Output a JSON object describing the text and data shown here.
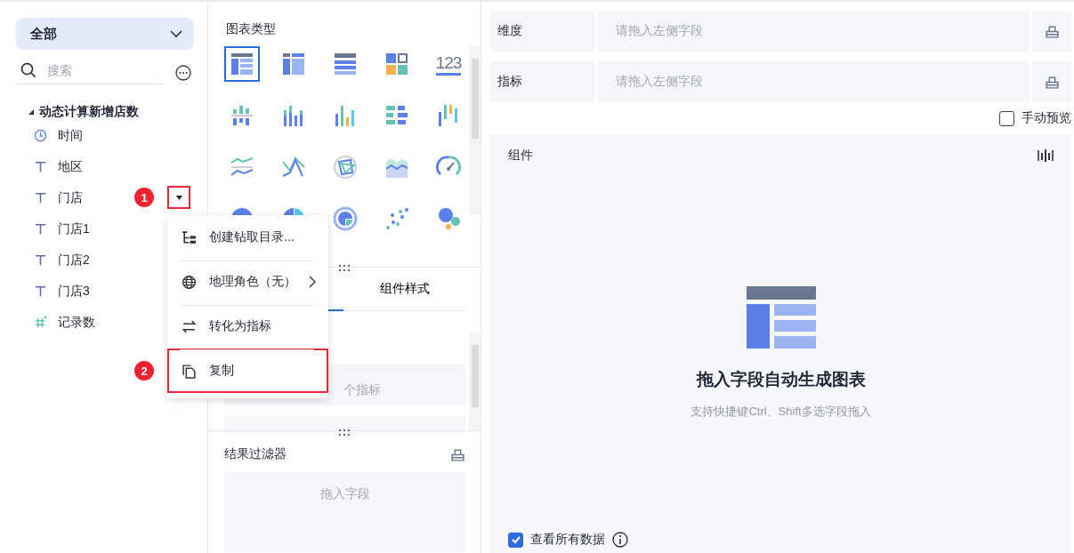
{
  "sidebar": {
    "scope_select": {
      "value": "全部"
    },
    "search": {
      "placeholder": "搜索"
    },
    "tree": [
      {
        "label": "动态计算新增店数",
        "expanded": true,
        "children": [
          {
            "label": "时间",
            "kind": "time"
          },
          {
            "label": "地区",
            "kind": "text"
          },
          {
            "label": "门店",
            "kind": "text",
            "badge": "1",
            "dropdown": true
          },
          {
            "label": "门店1",
            "kind": "text"
          },
          {
            "label": "门店2",
            "kind": "text"
          },
          {
            "label": "门店3",
            "kind": "text"
          },
          {
            "label": "记录数",
            "kind": "measure"
          }
        ]
      }
    ]
  },
  "context_menu": {
    "items": [
      {
        "label": "创建钻取目录...",
        "kind": "tree",
        "submenu": false,
        "highlighted": false
      },
      {
        "label": "地理角色（无）",
        "kind": "globe",
        "submenu": true,
        "highlighted": false
      },
      {
        "label": "转化为指标",
        "kind": "swap",
        "submenu": false,
        "highlighted": false
      },
      {
        "label": "复制",
        "kind": "copy",
        "submenu": false,
        "highlighted": true,
        "badge": "2"
      }
    ]
  },
  "chart_panel": {
    "title": "图表类型",
    "chart_types": [
      {
        "kind": "grouped-table",
        "selected": true
      },
      {
        "kind": "cross-table",
        "selected": false
      },
      {
        "kind": "detail-table",
        "selected": false
      },
      {
        "kind": "kpi-card",
        "selected": false
      },
      {
        "kind": "number",
        "selected": false,
        "label": "123"
      },
      {
        "kind": "split-bar",
        "selected": false
      },
      {
        "kind": "stacked-bar",
        "selected": false
      },
      {
        "kind": "bar",
        "selected": false
      },
      {
        "kind": "h-bar",
        "selected": false
      },
      {
        "kind": "range-bar",
        "selected": false
      },
      {
        "kind": "line",
        "selected": false
      },
      {
        "kind": "cross-line",
        "selected": false
      },
      {
        "kind": "radar",
        "selected": false
      },
      {
        "kind": "area",
        "selected": false
      },
      {
        "kind": "gauge",
        "selected": false
      },
      {
        "kind": "pie",
        "selected": false
      },
      {
        "kind": "multi-pie",
        "selected": false
      },
      {
        "kind": "ring",
        "selected": false
      },
      {
        "kind": "scatter",
        "selected": false
      },
      {
        "kind": "bubble",
        "selected": false
      }
    ],
    "tabs": [
      {
        "label": "组件样式",
        "selected": false
      }
    ],
    "fields": [
      {
        "placeholder": "个指标"
      }
    ],
    "filter": {
      "title": "结果过滤器",
      "placeholder": "拖入字段"
    }
  },
  "main": {
    "shelves": [
      {
        "label": "维度",
        "placeholder": "请拖入左侧字段"
      },
      {
        "label": "指标",
        "placeholder": "请拖入左侧字段"
      }
    ],
    "manual_preview": {
      "label": "手动预览",
      "checked": false
    },
    "component": {
      "title": "组件",
      "empty_title": "拖入字段自动生成图表",
      "empty_hint": "支持快捷键Ctrl、Shift多选字段拖入"
    },
    "view_all": {
      "label": "查看所有数据",
      "checked": true
    }
  }
}
